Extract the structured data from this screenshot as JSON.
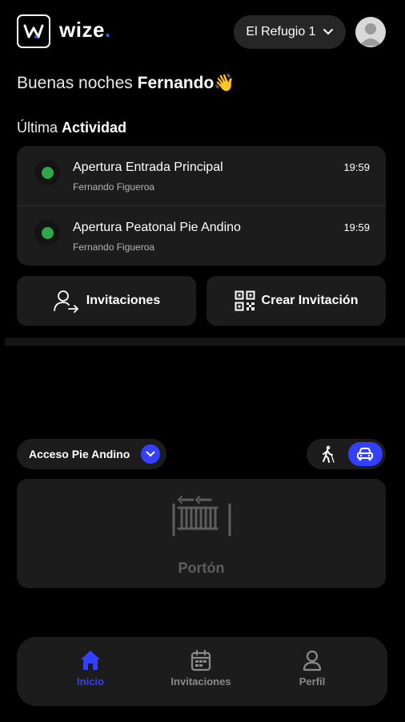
{
  "header": {
    "logo_letter": "w",
    "logo_text": "wize",
    "logo_dot": ".",
    "location_label": "El Refugio 1"
  },
  "greeting": {
    "prefix": "Buenas noches",
    "name": "Fernando",
    "emoji": "👋"
  },
  "activity": {
    "title_prefix": "Última",
    "title_bold": "Actividad",
    "items": [
      {
        "title": "Apertura Entrada Principal",
        "user": "Fernando Figueroa",
        "time": "19:59",
        "status_color": "#2ea84a"
      },
      {
        "title": "Apertura Peatonal Pie Andino",
        "user": "Fernando Figueroa",
        "time": "19:59",
        "status_color": "#2ea84a"
      }
    ]
  },
  "actions": {
    "invitations_label": "Invitaciones",
    "create_invitation_label": "Crear Invitación"
  },
  "access": {
    "selected": "Acceso Pie Andino",
    "mode_active": "vehicle"
  },
  "gate": {
    "label": "Portón"
  },
  "nav": {
    "items": [
      {
        "label": "Inicio",
        "icon": "home-icon",
        "active": true
      },
      {
        "label": "Invitaciones",
        "icon": "calendar-icon",
        "active": false
      },
      {
        "label": "Perfil",
        "icon": "user-icon",
        "active": false
      }
    ]
  },
  "colors": {
    "accent": "#3340ff",
    "background": "#000000",
    "card": "#1c1c1c",
    "status_green": "#2ea84a"
  }
}
